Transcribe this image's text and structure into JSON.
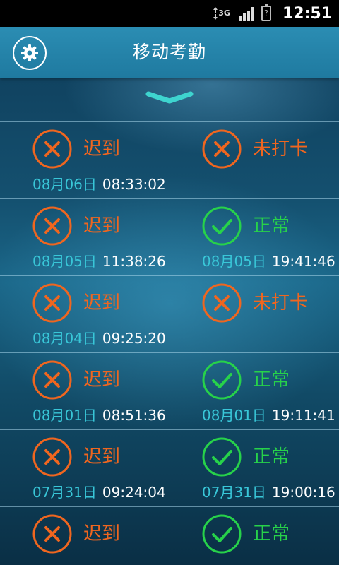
{
  "status_bar": {
    "network": "3G",
    "battery_glyph": "?",
    "time": "12:51"
  },
  "header": {
    "title": "移动考勤"
  },
  "colors": {
    "header": "#1f7aa0",
    "late": "#f0661f",
    "normal": "#27d24a",
    "date": "#39c7d8"
  },
  "records": [
    {
      "in": {
        "status": "late",
        "label": "迟到",
        "icon": "cross-icon",
        "date": "08月06日",
        "time": "08:33:02"
      },
      "out": {
        "status": "missed",
        "label": "未打卡",
        "icon": "cross-icon",
        "date": "",
        "time": ""
      }
    },
    {
      "in": {
        "status": "late",
        "label": "迟到",
        "icon": "cross-icon",
        "date": "08月05日",
        "time": "11:38:26"
      },
      "out": {
        "status": "normal",
        "label": "正常",
        "icon": "check-icon",
        "date": "08月05日",
        "time": "19:41:46"
      }
    },
    {
      "in": {
        "status": "late",
        "label": "迟到",
        "icon": "cross-icon",
        "date": "08月04日",
        "time": "09:25:20"
      },
      "out": {
        "status": "missed",
        "label": "未打卡",
        "icon": "cross-icon",
        "date": "",
        "time": ""
      }
    },
    {
      "in": {
        "status": "late",
        "label": "迟到",
        "icon": "cross-icon",
        "date": "08月01日",
        "time": "08:51:36"
      },
      "out": {
        "status": "normal",
        "label": "正常",
        "icon": "check-icon",
        "date": "08月01日",
        "time": "19:11:41"
      }
    },
    {
      "in": {
        "status": "late",
        "label": "迟到",
        "icon": "cross-icon",
        "date": "07月31日",
        "time": "09:24:04"
      },
      "out": {
        "status": "normal",
        "label": "正常",
        "icon": "check-icon",
        "date": "07月31日",
        "time": "19:00:16"
      }
    },
    {
      "in": {
        "status": "late",
        "label": "迟到",
        "icon": "cross-icon",
        "date": "",
        "time": ""
      },
      "out": {
        "status": "normal",
        "label": "正常",
        "icon": "check-icon",
        "date": "",
        "time": ""
      }
    }
  ]
}
